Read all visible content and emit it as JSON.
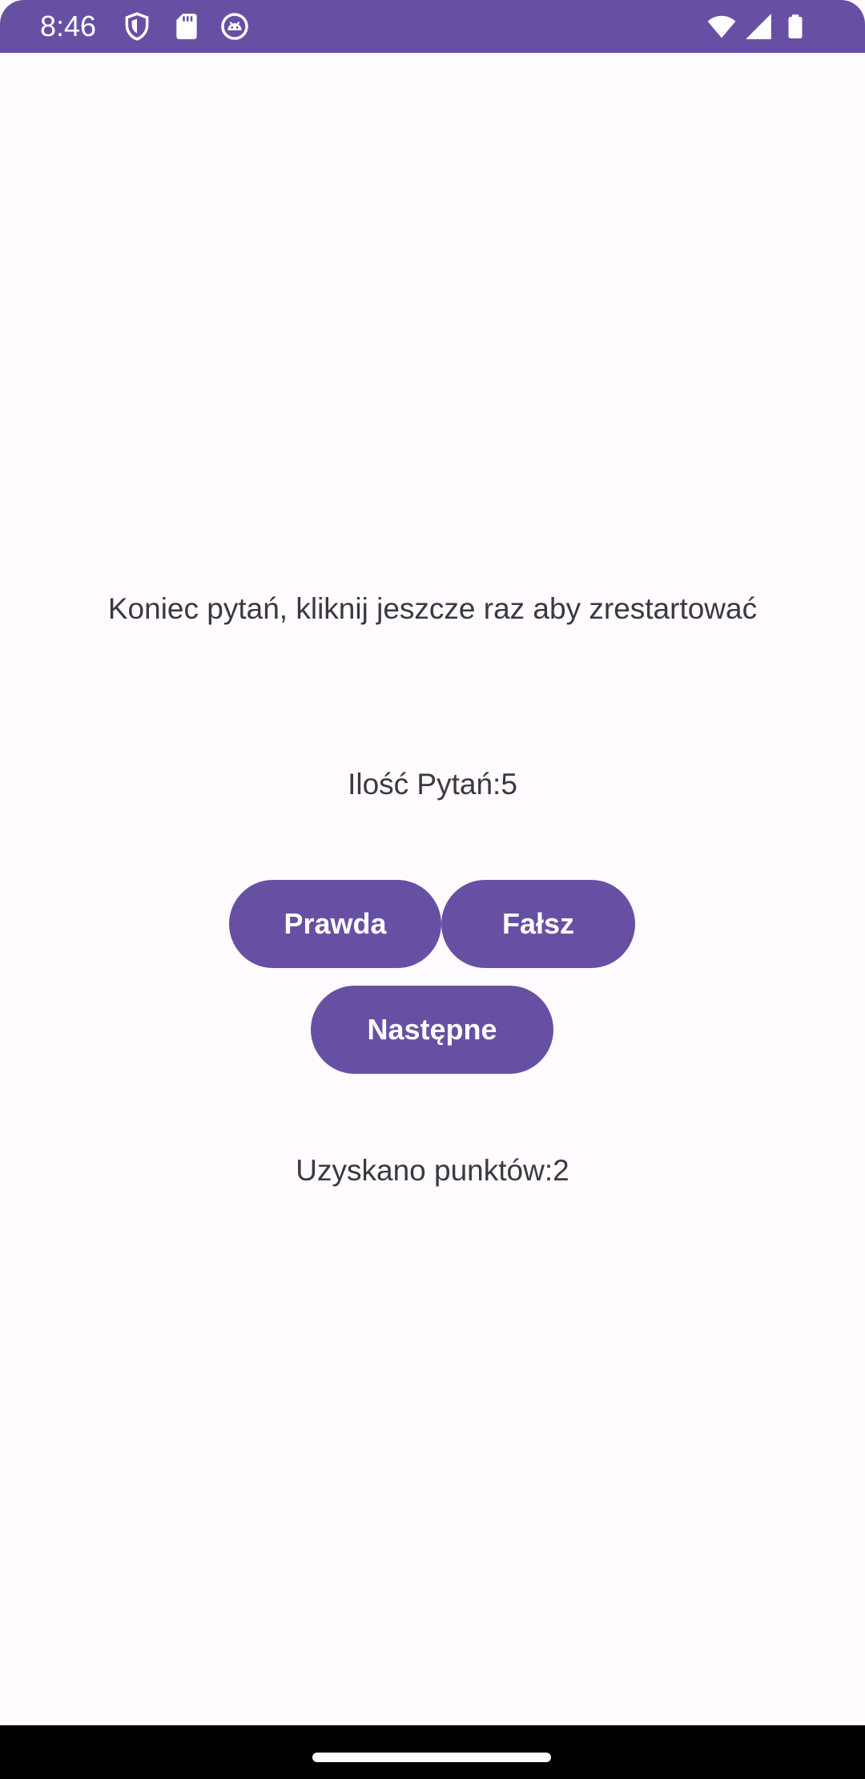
{
  "status_bar": {
    "time": "8:46",
    "icons": [
      "shield-icon",
      "sd-card-icon",
      "android-debug-icon",
      "wifi-icon",
      "cellular-signal-icon",
      "battery-icon"
    ],
    "background": "#6750A4"
  },
  "quiz": {
    "message": "Koniec pytań, kliknij jeszcze raz aby zrestartować",
    "question_count": "Ilość Pytań:5",
    "score": "Uzyskano punktów:2"
  },
  "buttons": {
    "true_label": "Prawda",
    "false_label": "Fałsz",
    "next_label": "Następne"
  },
  "colors": {
    "accent": "#6750A4",
    "background": "#FFFBFE",
    "text": "#3B3840"
  }
}
